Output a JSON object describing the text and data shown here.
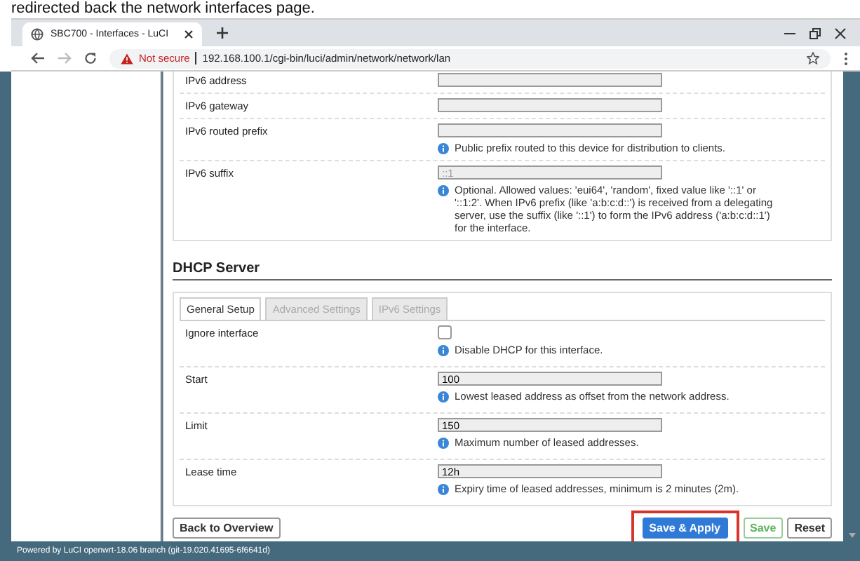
{
  "caption": "redirected back the network interfaces page.",
  "browser": {
    "tab_title": "SBC700 - Interfaces - LuCI",
    "security": "Not secure",
    "url": "192.168.100.1/cgi-bin/luci/admin/network/network/lan"
  },
  "ipv6_rows": [
    {
      "label": "IPv6 address",
      "value": ""
    },
    {
      "label": "IPv6 gateway",
      "value": ""
    },
    {
      "label": "IPv6 routed prefix",
      "value": "",
      "help": "Public prefix routed to this device for distribution to clients."
    },
    {
      "label": "IPv6 suffix",
      "placeholder": "::1",
      "help": "Optional. Allowed values: 'eui64', 'random', fixed value like '::1' or '::1:2'. When IPv6 prefix (like 'a:b:c:d::') is received from a delegating server, use the suffix (like '::1') to form the IPv6 address ('a:b:c:d::1') for the interface."
    }
  ],
  "dhcp": {
    "title": "DHCP Server",
    "tabs": [
      {
        "label": "General Setup",
        "selected": true
      },
      {
        "label": "Advanced Settings",
        "selected": false
      },
      {
        "label": "IPv6 Settings",
        "selected": false
      }
    ],
    "rows": [
      {
        "kind": "checkbox",
        "label": "Ignore interface",
        "checked": false,
        "help": "Disable DHCP for this interface."
      },
      {
        "kind": "text",
        "label": "Start",
        "value": "100",
        "help": "Lowest leased address as offset from the network address."
      },
      {
        "kind": "text",
        "label": "Limit",
        "value": "150",
        "help": "Maximum number of leased addresses."
      },
      {
        "kind": "text",
        "label": "Lease time",
        "value": "12h",
        "help": "Expiry time of leased addresses, minimum is 2 minutes (2m)."
      }
    ]
  },
  "buttons": [
    {
      "kind": "plain",
      "label": "Back to Overview",
      "highlighted": false
    },
    {
      "kind": "primary",
      "label": "Save & Apply",
      "highlighted": true
    },
    {
      "kind": "save",
      "label": "Save",
      "highlighted": false
    },
    {
      "kind": "reset",
      "label": "Reset",
      "highlighted": false
    }
  ],
  "footer": "Powered by LuCI openwrt-18.06 branch (git-19.020.41695-6f6641d)"
}
